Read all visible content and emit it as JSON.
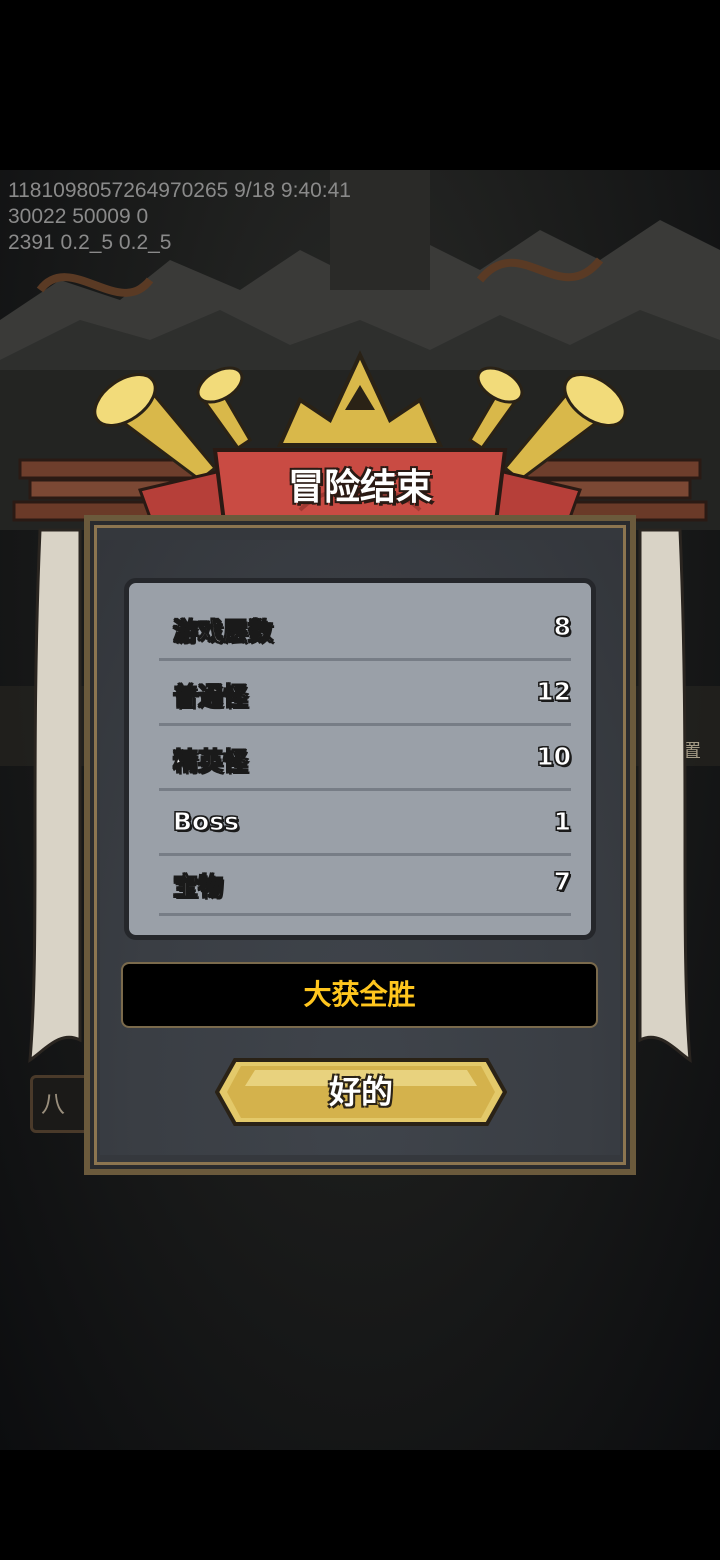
{
  "debug": {
    "line1": "1181098057264970265 9/18 9:40:41",
    "line2": "30022 50009 0",
    "line3": "2391 0.2_5 0.2_5"
  },
  "background": {
    "left_tab_text": "八",
    "settings_text": "设置"
  },
  "dialog": {
    "title": "冒险结束",
    "stats": [
      {
        "label": "游戏层数",
        "value": "8"
      },
      {
        "label": "普通怪",
        "value": "12"
      },
      {
        "label": "精英怪",
        "value": "10"
      },
      {
        "label": "Boss",
        "value": "1"
      },
      {
        "label": "宝物",
        "value": "7"
      }
    ],
    "result_text": "大获全胜",
    "ok_label": "好的"
  },
  "colors": {
    "result_text": "#ffc61e",
    "banner_red": "#c0463f",
    "gold": "#d9b84a",
    "panel": "#9aa0a8"
  }
}
